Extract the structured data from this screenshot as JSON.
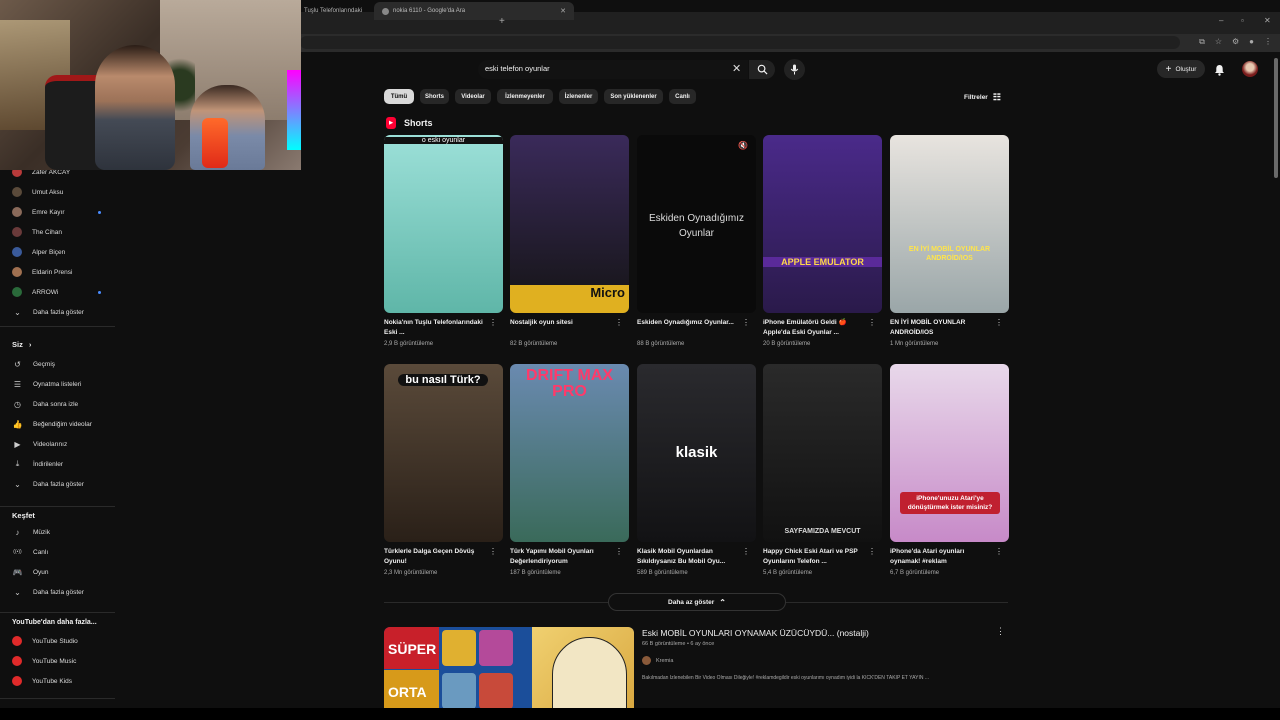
{
  "browser": {
    "tabs": [
      {
        "label": "Tuşlu Telefonlarındaki"
      },
      {
        "label": "nokia 6110 - Google'da Ara"
      }
    ],
    "window_controls": [
      "–",
      "▫",
      "✕"
    ]
  },
  "header": {
    "search_value": "eski telefon oyunlar",
    "create_label": "Oluştur"
  },
  "chips": [
    "Tümü",
    "Shorts",
    "Videolar",
    "İzlenmeyenler",
    "İzlenenler",
    "Son yüklenenler",
    "Canlı"
  ],
  "filters_label": "Filtreler",
  "sidebar": {
    "subscriptions": [
      {
        "label": "Zafer AKCAY",
        "color": "#b83a3a",
        "dot": false
      },
      {
        "label": "Umut Aksu",
        "color": "#5a4a3a",
        "dot": false
      },
      {
        "label": "Emre Kayır",
        "color": "#8a6a5a",
        "dot": true
      },
      {
        "label": "The Cihan",
        "color": "#6a3a3a",
        "dot": false
      },
      {
        "label": "Alper Biçen",
        "color": "#3a5a9a",
        "dot": false
      },
      {
        "label": "Eldarin Prensi",
        "color": "#a07050",
        "dot": false
      },
      {
        "label": "ARROWi",
        "color": "#2a6a3a",
        "dot": true
      }
    ],
    "show_more_subs": "Daha fazla göster",
    "you_heading": "Siz",
    "you_items": [
      {
        "label": "Geçmiş",
        "icon": "history-icon",
        "glyph": "↺"
      },
      {
        "label": "Oynatma listeleri",
        "icon": "playlist-icon",
        "glyph": "☰"
      },
      {
        "label": "Daha sonra izle",
        "icon": "clock-icon",
        "glyph": "◷"
      },
      {
        "label": "Beğendiğim videolar",
        "icon": "thumbs-up-icon",
        "glyph": "👍"
      },
      {
        "label": "Videolarınız",
        "icon": "video-icon",
        "glyph": "▶"
      },
      {
        "label": "İndirilenler",
        "icon": "download-icon",
        "glyph": "⤓"
      },
      {
        "label": "Daha fazla göster",
        "icon": "chevron-down-icon",
        "glyph": "⌄"
      }
    ],
    "explore_heading": "Keşfet",
    "explore_items": [
      {
        "label": "Müzik",
        "icon": "music-icon",
        "glyph": "♪"
      },
      {
        "label": "Canlı",
        "icon": "live-icon",
        "glyph": "((•))"
      },
      {
        "label": "Oyun",
        "icon": "gamepad-icon",
        "glyph": "🎮"
      },
      {
        "label": "Daha fazla göster",
        "icon": "chevron-down-icon",
        "glyph": "⌄"
      }
    ],
    "more_heading": "YouTube'dan daha fazla...",
    "more_items": [
      {
        "label": "YouTube Studio"
      },
      {
        "label": "YouTube Music"
      },
      {
        "label": "YouTube Kids"
      }
    ]
  },
  "shorts": {
    "heading": "Shorts",
    "items": [
      {
        "title": "Nokia'nın Tuşlu Telefonlarındaki Eski ...",
        "views": "2,9 B görüntüleme",
        "thumb_text": "o eski oyunlar",
        "bg": "linear-gradient(180deg,#9ce0d8,#5fb6a8)"
      },
      {
        "title": "Nostaljik oyun sitesi",
        "views": "82 B görüntüleme",
        "thumb_text": "Micro",
        "bg": "linear-gradient(180deg,#3a2a5a,#141414)"
      },
      {
        "title": "Eskiden Oynadığımız Oyunlar...",
        "views": "88 B görüntüleme",
        "thumb_text": "Eskiden Oynadığımız Oyunlar",
        "bg": "#0a0a0a"
      },
      {
        "title": "iPhone Emülatörü Geldi 🍎 Apple'da Eski Oyunlar ...",
        "views": "20 B görüntüleme",
        "thumb_text": "APPLE EMULATOR",
        "bg": "linear-gradient(180deg,#4a2a8a,#2a1a4a)"
      },
      {
        "title": "EN İYİ MOBİL OYUNLAR ANDROİD/IOS",
        "views": "1 Mn görüntüleme",
        "thumb_text": "EN İYİ MOBİL OYUNLAR ANDROİD/IOS",
        "bg": "linear-gradient(180deg,#e8e4df,#9aa6a8)"
      },
      {
        "title": "Türklerle Dalga Geçen Dövüş Oyunu!",
        "views": "2,3 Mn görüntüleme",
        "thumb_text": "bu nasıl Türk?",
        "bg": "linear-gradient(180deg,#5a4a3a,#2a2018)"
      },
      {
        "title": "Türk Yapımı Mobil Oyunları Değerlendiriyorum",
        "views": "187 B görüntüleme",
        "thumb_text": "DRIFT MAX PRO",
        "bg": "linear-gradient(180deg,#6a8ab0,#3a6a5a)"
      },
      {
        "title": "Klasik Mobil Oyunlardan Sıkıldıysanız Bu Mobil Oyu...",
        "views": "589 B görüntüleme",
        "thumb_text": "klasik",
        "bg": "linear-gradient(180deg,#2a2a2e,#121214)"
      },
      {
        "title": "Happy Chick Eski Atari ve PSP Oyunlarını Telefon ...",
        "views": "5,4 B görüntüleme",
        "thumb_text": "SAYFAMIZDA MEVCUT",
        "bg": "linear-gradient(180deg,#2a2a2a,#111)"
      },
      {
        "title": "iPhone'da Atari oyunları oynamak! #reklam",
        "views": "6,7 B görüntüleme",
        "thumb_text": "iPhone'unuzu Atari'ye dönüştürmek ister misiniz?",
        "bg": "linear-gradient(180deg,#e8d8ea,#c78ac8)"
      }
    ],
    "show_less": "Daha az göster"
  },
  "video": {
    "title": "Eski MOBİL OYUNLARI OYNAMAK ÜZÜCÜYDÜ... (nostalji)",
    "meta": "66 B görüntüleme • 6 ay önce",
    "channel": "Kremia",
    "description": "Bakılmadan İzlenebilen Bir Video Olması Dileğiyle! #reklamdegildir eski oyunlarımı oynadım iyidi la KICK'DEN TAKİP ET YAYIN ...",
    "thumb_words": [
      "SÜPER",
      "ORTA"
    ]
  }
}
